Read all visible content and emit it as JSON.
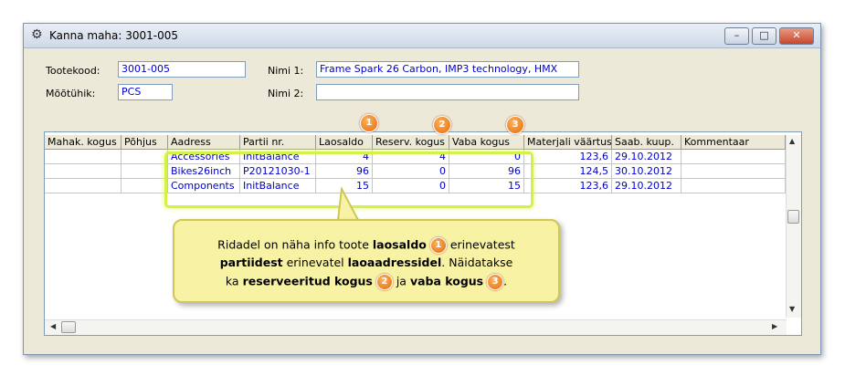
{
  "window": {
    "title": "Kanna maha: 3001-005",
    "buttons": {
      "minimize": "–",
      "maximize": "□",
      "close": "✕"
    }
  },
  "form": {
    "tootekood_label": "Tootekood:",
    "tootekood_value": "3001-005",
    "mootuhik_label": "Mõõtühik:",
    "mootuhik_value": "PCS",
    "nimi1_label": "Nimi 1:",
    "nimi1_value": "Frame Spark 26 Carbon, IMP3 technology, HMX",
    "nimi2_label": "Nimi 2:",
    "nimi2_value": ""
  },
  "table": {
    "columns": [
      "Mahak. kogus",
      "Põhjus",
      "Aadress",
      "Partii nr.",
      "Laosaldo",
      "Reserv. kogus",
      "Vaba kogus",
      "Materjali väärtus",
      "Saab. kuup.",
      "Kommentaar"
    ],
    "rows": [
      [
        "",
        "",
        "Accessories",
        "InitBalance",
        "4",
        "4",
        "0",
        "123,6",
        "29.10.2012",
        ""
      ],
      [
        "",
        "",
        "Bikes26inch",
        "P20121030-1",
        "96",
        "0",
        "96",
        "124,5",
        "30.10.2012",
        ""
      ],
      [
        "",
        "",
        "Components",
        "InitBalance",
        "15",
        "0",
        "15",
        "123,6",
        "29.10.2012",
        ""
      ]
    ]
  },
  "badges": [
    "1",
    "2",
    "3"
  ],
  "callout": {
    "l1a": "Ridadel on näha info toote ",
    "l1b": "laosaldo",
    "l1c": " erinevatest",
    "l2a": "partiidest",
    "l2b": " erinevatel ",
    "l2c": "laoaadressidel",
    "l2d": ". Näidatakse",
    "l3a": "ka ",
    "l3b": "reserveeritud kogus",
    "l3c": " ja ",
    "l3d": "vaba kogus",
    "l3e": "."
  },
  "colors": {
    "value_text": "#0000cc",
    "highlight": "#d4f04a",
    "badge": "#e46a0a",
    "callout_bg": "#f8f3a4"
  }
}
